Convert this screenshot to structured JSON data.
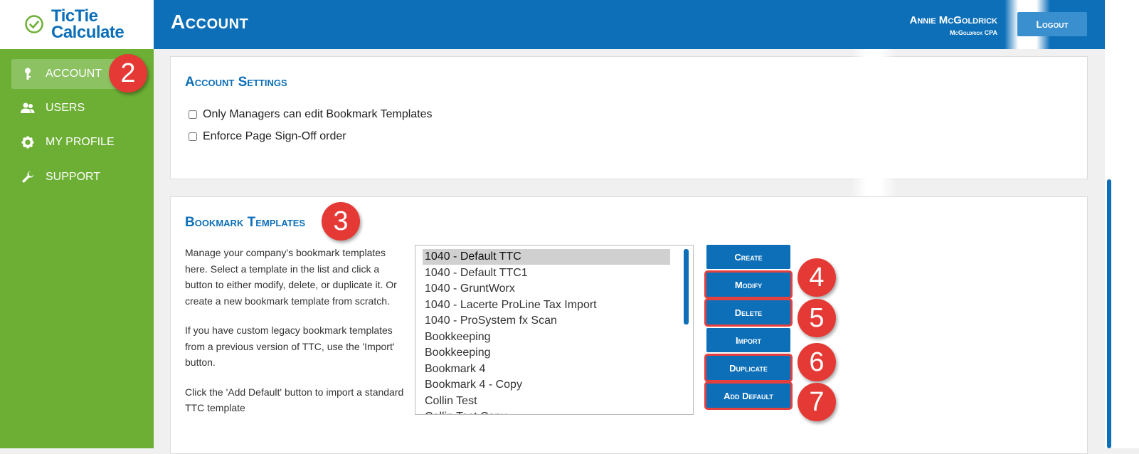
{
  "logo": {
    "line1": "TicTie",
    "line2": "Calculate",
    "icon": "check-circle-icon"
  },
  "sidebar": {
    "items": [
      {
        "label": "ACCOUNT",
        "icon": "key-icon",
        "active": true
      },
      {
        "label": "USERS",
        "icon": "users-icon",
        "active": false
      },
      {
        "label": "MY PROFILE",
        "icon": "gear-icon",
        "active": false
      },
      {
        "label": "SUPPORT",
        "icon": "wrench-icon",
        "active": false
      }
    ]
  },
  "header": {
    "title": "Account",
    "user_name": "Annie McGoldrick",
    "user_company": "McGoldrick CPA",
    "logout_label": "Logout"
  },
  "account_settings": {
    "title": "Account Settings",
    "options": [
      {
        "label": "Only Managers can edit Bookmark Templates",
        "checked": false
      },
      {
        "label": "Enforce Page Sign-Off order",
        "checked": false
      }
    ]
  },
  "bookmark_templates": {
    "title": "Bookmark Templates",
    "description": [
      "Manage your company's bookmark templates here. Select a template in the list and click a button to either modify, delete, or duplicate it. Or create a new bookmark template from scratch.",
      "If you have custom legacy bookmark templates from a previous version of TTC, use the 'Import' button.",
      "Click the 'Add Default' button to import a standard TTC template"
    ],
    "templates": [
      "1040 - Default TTC",
      "1040 - Default TTC1",
      "1040 - GruntWorx",
      "1040 - Lacerte ProLine Tax Import",
      "1040 - ProSystem fx Scan",
      "Bookkeeping",
      "Bookkeeping",
      "Bookmark 4",
      "Bookmark 4 - Copy",
      "Collin Test",
      "Collin Test Copy"
    ],
    "selected": "1040 - Default TTC",
    "buttons": {
      "create": "Create",
      "modify": "Modify",
      "delete": "Delete",
      "import": "Import",
      "duplicate": "Duplicate",
      "add_default": "Add Default"
    }
  },
  "callouts": [
    "2",
    "3",
    "4",
    "5",
    "6",
    "7"
  ],
  "colors": {
    "brand_blue": "#0c6fb8",
    "sidebar_green": "#6daf35",
    "callout_red": "#e53935"
  }
}
